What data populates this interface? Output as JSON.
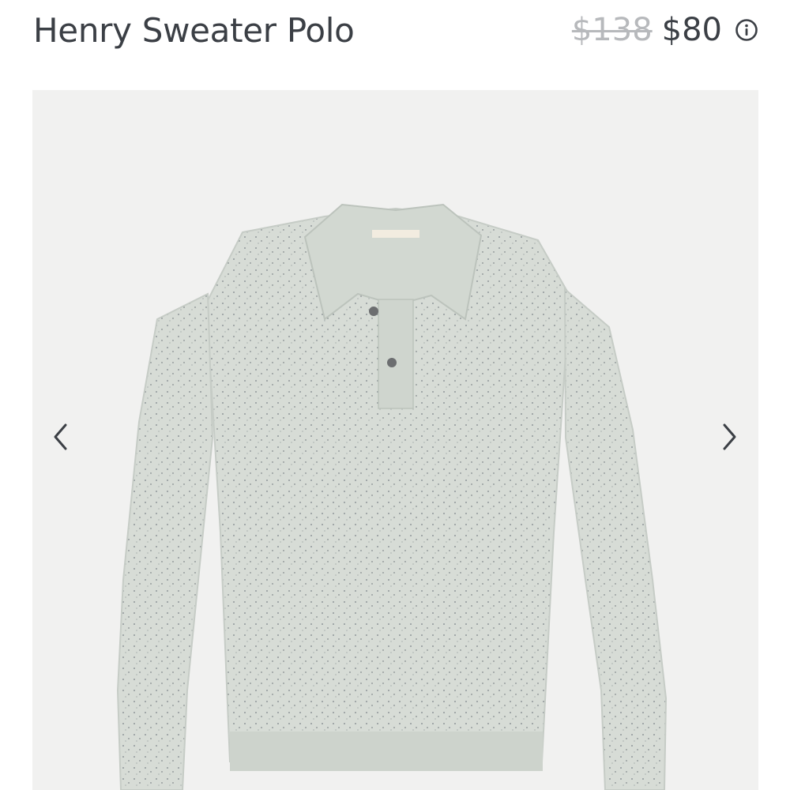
{
  "product": {
    "title": "Henry Sweater Polo",
    "original_price": "$138",
    "sale_price": "$80",
    "info_icon": "info-circle-icon"
  },
  "gallery": {
    "image": "sweater-polo-product-photo",
    "prev_icon": "chevron-left-icon",
    "next_icon": "chevron-right-icon"
  },
  "colors": {
    "text": "#3b3f45",
    "strike": "#b7b9bc",
    "gallery_bg": "#f1f1f0",
    "sweater": "#d7dcd6"
  }
}
